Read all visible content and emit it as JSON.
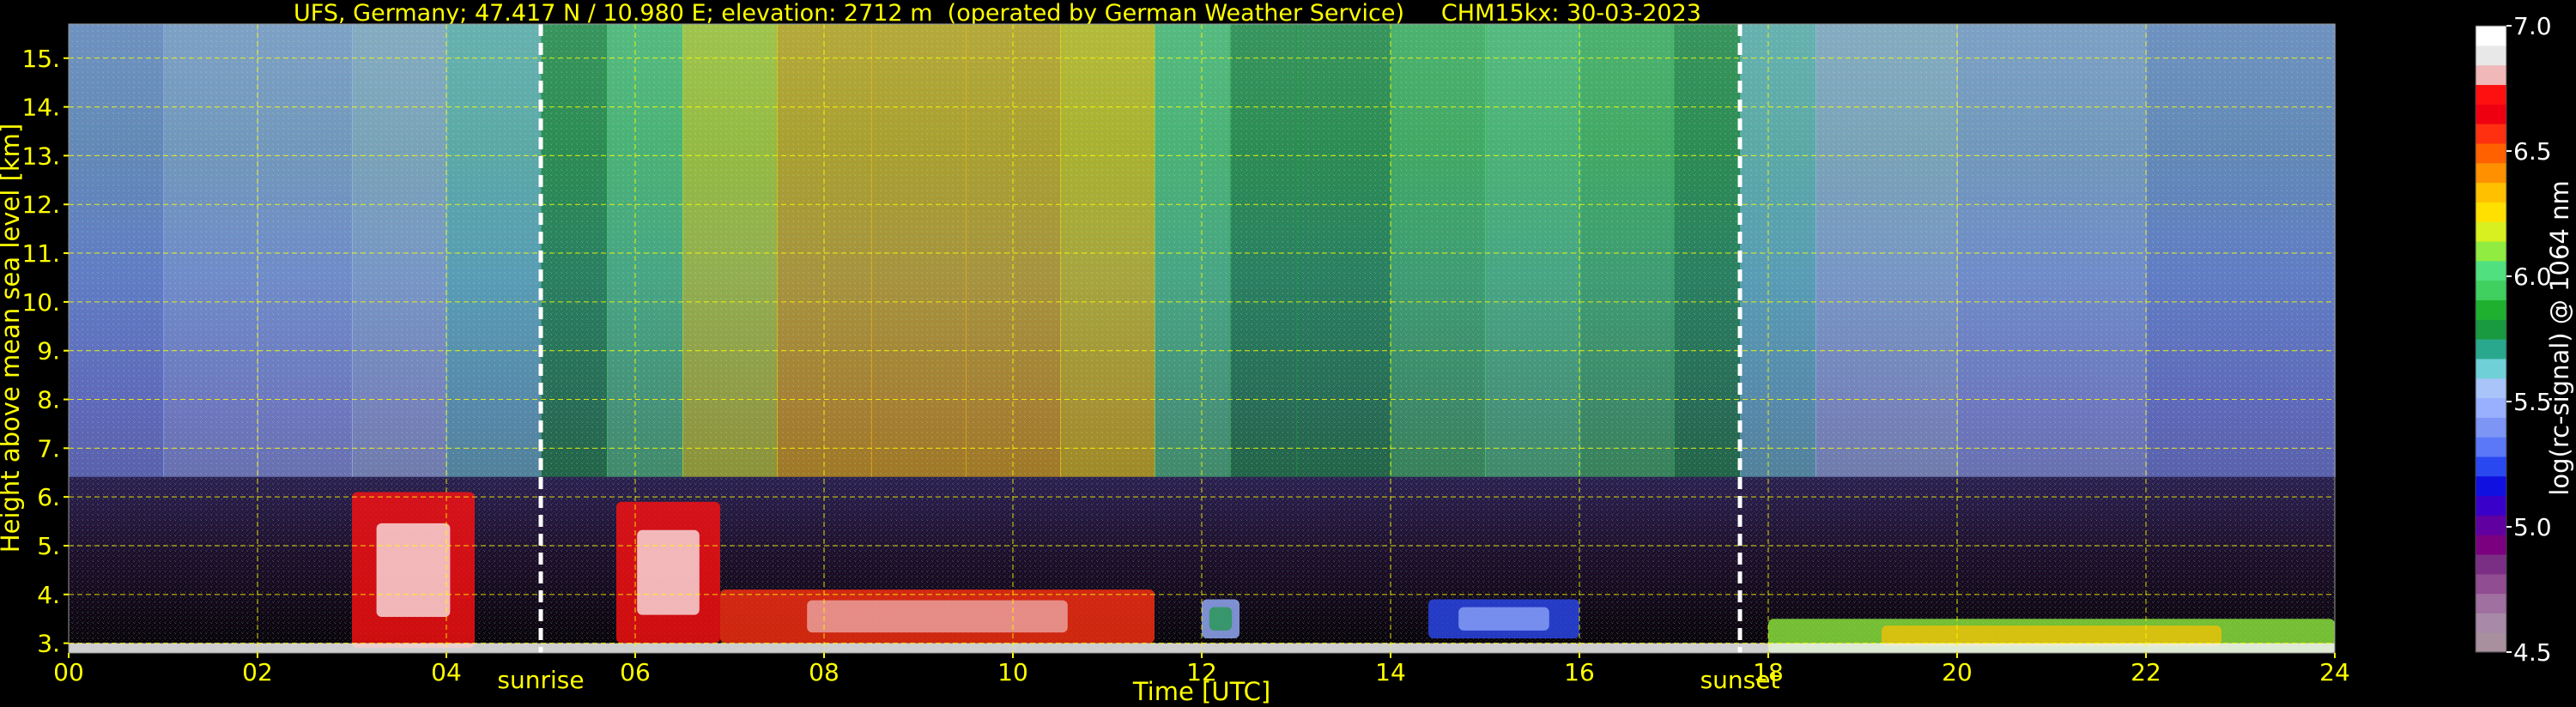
{
  "chart_data": {
    "type": "heatmap",
    "title": "UFS, Germany; 47.417 N / 10.980 E; elevation: 2712 m  (operated by German Weather Service)     CHM15kx: 30-03-2023",
    "xlabel": "Time [UTC]",
    "ylabel": "Height above mean sea level [km]",
    "xlim": [
      0,
      24
    ],
    "ylim": [
      2.8,
      15.7
    ],
    "x_ticks": [
      "00",
      "02",
      "04",
      "06",
      "08",
      "10",
      "12",
      "14",
      "16",
      "18",
      "20",
      "22",
      "24"
    ],
    "y_ticks": [
      "3.",
      "4.",
      "5.",
      "6.",
      "7.",
      "8.",
      "9.",
      "10.",
      "11.",
      "12.",
      "13.",
      "14.",
      "15."
    ],
    "grid": true,
    "events": [
      {
        "label": "sunrise",
        "x": 5.0
      },
      {
        "label": "sunset",
        "x": 17.7
      }
    ],
    "colorbar": {
      "label": "log(rc-signal) @ 1064 nm",
      "range": [
        4.5,
        7.0
      ],
      "ticks": [
        "4.5",
        "5.0",
        "5.5",
        "6.0",
        "6.5",
        "7.0"
      ],
      "colors": [
        "#a8909f",
        "#a88aa8",
        "#a070a0",
        "#904d92",
        "#7a2f85",
        "#7a0080",
        "#6000a0",
        "#3800c8",
        "#1010e0",
        "#2a48f0",
        "#5a78f8",
        "#7d95f5",
        "#99b0ff",
        "#a8c4f8",
        "#70d0d8",
        "#2aa88e",
        "#1a9a40",
        "#20b030",
        "#40d060",
        "#50e080",
        "#90ec40",
        "#d8f020",
        "#ffe000",
        "#ffc000",
        "#ff9000",
        "#ff6000",
        "#ff3010",
        "#ee0010",
        "#ff1010",
        "#f0b8b8",
        "#e8e8e8",
        "#ffffff"
      ]
    },
    "series": [
      {
        "x": 0.0,
        "level": 0.35
      },
      {
        "x": 1.0,
        "level": 0.38
      },
      {
        "x": 2.0,
        "level": 0.4
      },
      {
        "x": 3.0,
        "level": 0.4
      },
      {
        "x": 4.0,
        "level": 0.42
      },
      {
        "x": 5.0,
        "level": 0.48
      },
      {
        "x": 5.7,
        "level": 0.58
      },
      {
        "x": 6.5,
        "level": 0.66
      },
      {
        "x": 7.5,
        "level": 0.72
      },
      {
        "x": 8.5,
        "level": 0.75
      },
      {
        "x": 9.5,
        "level": 0.74
      },
      {
        "x": 10.5,
        "level": 0.72
      },
      {
        "x": 11.5,
        "level": 0.7
      },
      {
        "x": 12.3,
        "level": 0.55
      },
      {
        "x": 13.0,
        "level": 0.45
      },
      {
        "x": 14.0,
        "level": 0.56
      },
      {
        "x": 15.0,
        "level": 0.62
      },
      {
        "x": 16.0,
        "level": 0.6
      },
      {
        "x": 17.0,
        "level": 0.55
      },
      {
        "x": 17.7,
        "level": 0.48
      },
      {
        "x": 18.5,
        "level": 0.42
      },
      {
        "x": 20.0,
        "level": 0.4
      },
      {
        "x": 22.0,
        "level": 0.38
      },
      {
        "x": 24.0,
        "level": 0.36
      }
    ],
    "features": [
      {
        "name": "cloud",
        "x": [
          3.0,
          4.3
        ],
        "y": [
          2.9,
          6.1
        ],
        "level": 0.9
      },
      {
        "name": "cloud",
        "x": [
          5.8,
          6.9
        ],
        "y": [
          3.0,
          5.9
        ],
        "level": 0.9
      },
      {
        "name": "cloud",
        "x": [
          6.9,
          11.5
        ],
        "y": [
          3.0,
          4.1
        ],
        "level": 0.85
      },
      {
        "name": "cloud",
        "x": [
          12.0,
          12.4
        ],
        "y": [
          3.1,
          3.9
        ],
        "level": 0.4
      },
      {
        "name": "cloud",
        "x": [
          14.4,
          16.0
        ],
        "y": [
          3.1,
          3.9
        ],
        "level": 0.3
      },
      {
        "name": "aerosol",
        "x": [
          18.0,
          24.0
        ],
        "y": [
          2.8,
          3.5
        ],
        "level": 0.65
      }
    ]
  }
}
